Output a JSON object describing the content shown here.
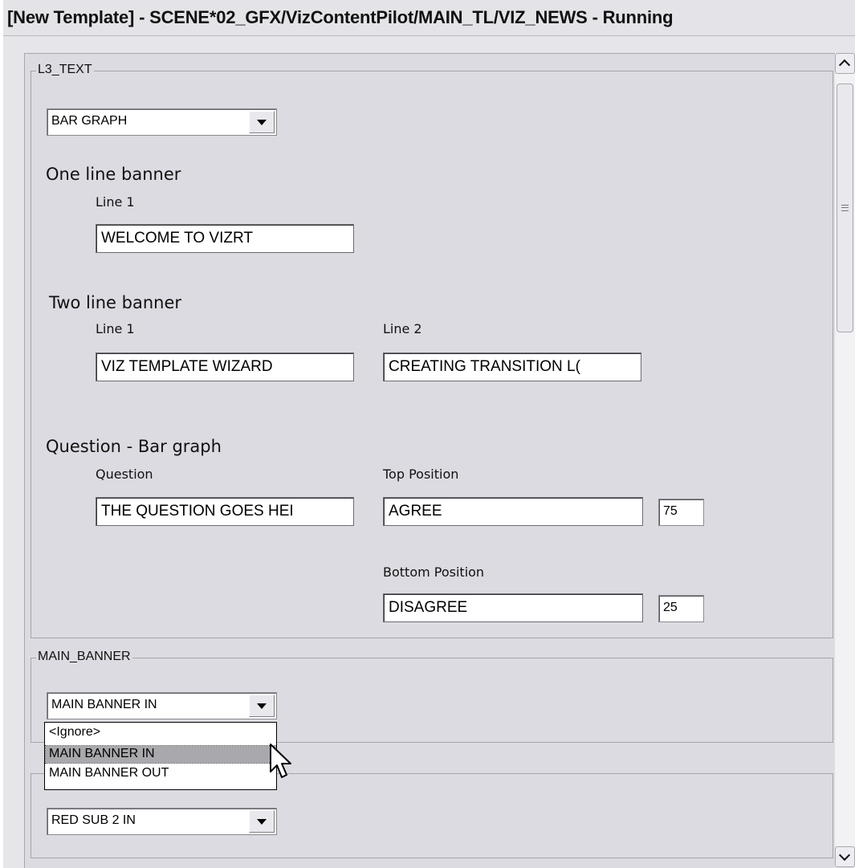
{
  "window": {
    "title": "[New Template] - SCENE*02_GFX/VizContentPilot/MAIN_TL/VIZ_NEWS - Running"
  },
  "l3_text": {
    "group_label": "L3_TEXT",
    "mode_select": "BAR GRAPH",
    "one_line": {
      "heading": "One line banner",
      "line1_label": "Line 1",
      "line1_value": "WELCOME TO VIZRT"
    },
    "two_line": {
      "heading": "Two line banner",
      "line1_label": "Line 1",
      "line1_value": "VIZ TEMPLATE WIZARD",
      "line2_label": "Line 2",
      "line2_value": "CREATING TRANSITION L("
    },
    "question": {
      "heading": "Question - Bar graph",
      "question_label": "Question",
      "question_value": "THE QUESTION GOES HEI",
      "top_label": "Top Position",
      "top_value": "AGREE",
      "top_number": "75",
      "bottom_label": "Bottom Position",
      "bottom_value": "DISAGREE",
      "bottom_number": "25"
    }
  },
  "main_banner": {
    "group_label": "MAIN_BANNER",
    "select_value": "MAIN BANNER IN",
    "options": [
      "<Ignore>",
      "MAIN BANNER IN",
      "MAIN BANNER OUT"
    ]
  },
  "third_group": {
    "group_label": "",
    "select_value": "RED SUB 2 IN"
  }
}
